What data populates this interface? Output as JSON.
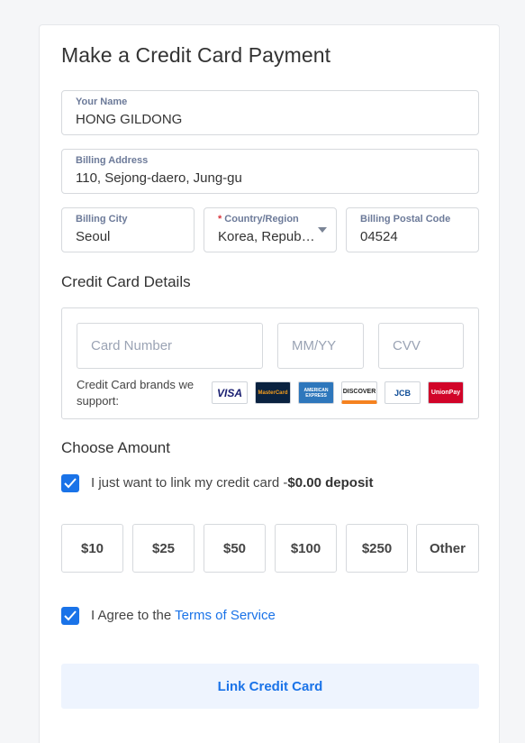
{
  "form": {
    "title": "Make a Credit Card Payment",
    "your_name": {
      "label": "Your Name",
      "value": "HONG GILDONG"
    },
    "billing_address": {
      "label": "Billing Address",
      "value": "110, Sejong-daero, Jung-gu"
    },
    "billing_city": {
      "label": "Billing City",
      "value": "Seoul"
    },
    "country": {
      "required_mark": "*",
      "label": "Country/Region",
      "value": "Korea, Republic of"
    },
    "postal_code": {
      "label": "Billing Postal Code",
      "value": "04524"
    }
  },
  "card_details": {
    "heading": "Credit Card Details",
    "card_number_placeholder": "Card Number",
    "expiry_placeholder": "MM/YY",
    "cvv_placeholder": "CVV",
    "brands_text": "Credit Card brands we support:",
    "brands": [
      {
        "name": "visa-logo",
        "text": "VISA",
        "color": "#1a1f71"
      },
      {
        "name": "mastercard-logo",
        "text": "MasterCard",
        "color": "#eb001b"
      },
      {
        "name": "amex-logo",
        "text": "AMERICAN EXPRESS",
        "color": "#2e77bc"
      },
      {
        "name": "discover-logo",
        "text": "DISCOVER",
        "color": "#f58220"
      },
      {
        "name": "jcb-logo",
        "text": "JCB",
        "color": "#0e4c96"
      },
      {
        "name": "unionpay-logo",
        "text": "UnionPay",
        "color": "#d10429"
      }
    ]
  },
  "amount": {
    "heading": "Choose Amount",
    "link_only_label": "I just want to link my credit card -",
    "link_only_bold": "$0.00 deposit",
    "link_only_checked": true,
    "options": [
      "$10",
      "$25",
      "$50",
      "$100",
      "$250",
      "Other"
    ]
  },
  "terms": {
    "checked": true,
    "prefix": "I Agree to the ",
    "link": "Terms of Service"
  },
  "submit_label": "Link Credit Card",
  "colors": {
    "accent": "#1a73e8",
    "label": "#6c7a99",
    "submit_bg": "#eef4fe"
  }
}
